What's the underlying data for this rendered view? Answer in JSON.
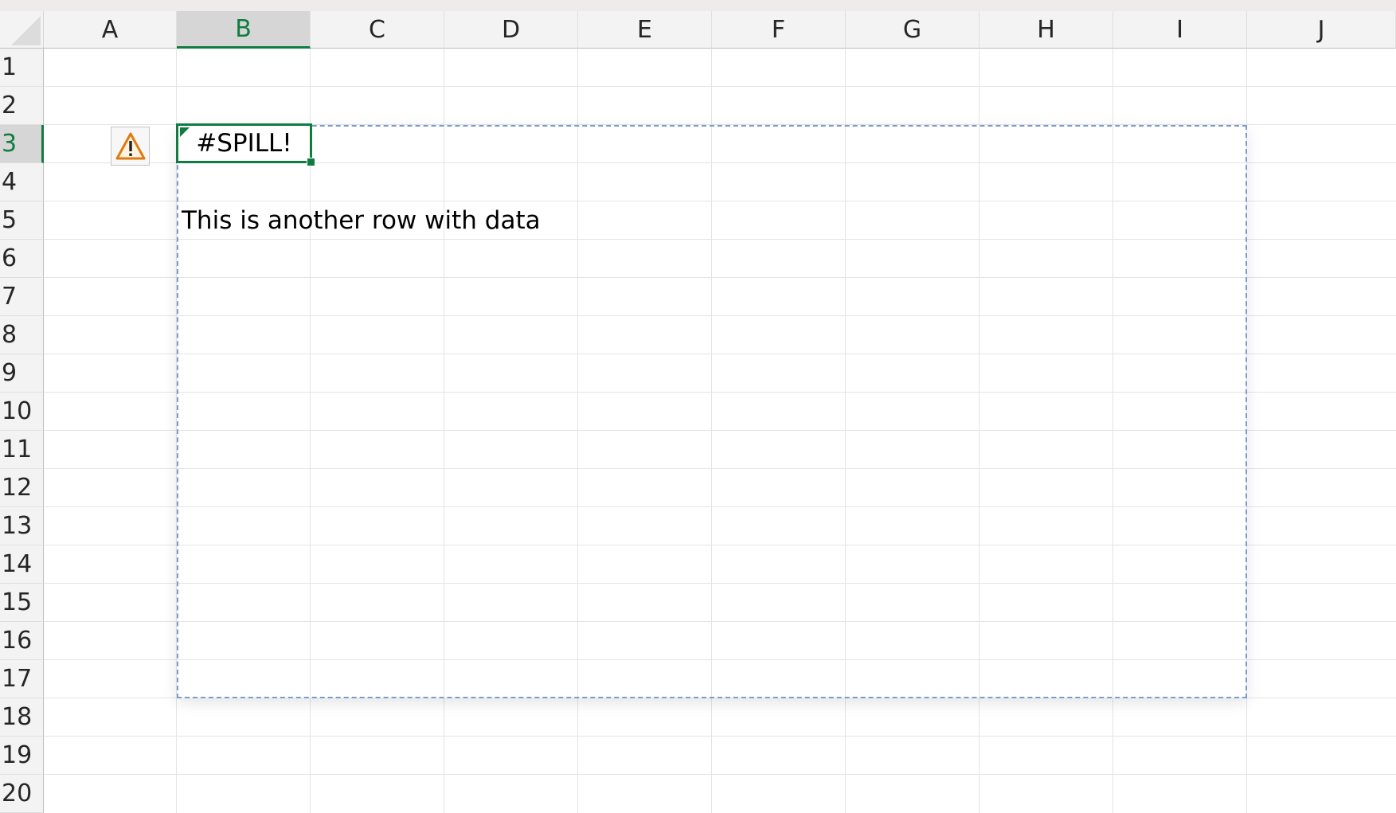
{
  "columns": [
    "A",
    "B",
    "C",
    "D",
    "E",
    "F",
    "G",
    "H",
    "I",
    "J"
  ],
  "rows": [
    "1",
    "2",
    "3",
    "4",
    "5",
    "6",
    "7",
    "8",
    "9",
    "10",
    "11",
    "12",
    "13",
    "14",
    "15",
    "16",
    "17",
    "18",
    "19",
    "20"
  ],
  "selected_column": "B",
  "selected_row": "3",
  "active_cell": {
    "ref": "B3",
    "value": "#SPILL!"
  },
  "cells": {
    "B5": "This is another row with data"
  },
  "error_button_icon": "warning-triangle-icon",
  "colors": {
    "accent": "#107c41",
    "spill_border": "#7b9bd1",
    "warning": "#e07a10",
    "header_bg": "#f3f3f3",
    "header_selected_bg": "#d6d6d6"
  }
}
